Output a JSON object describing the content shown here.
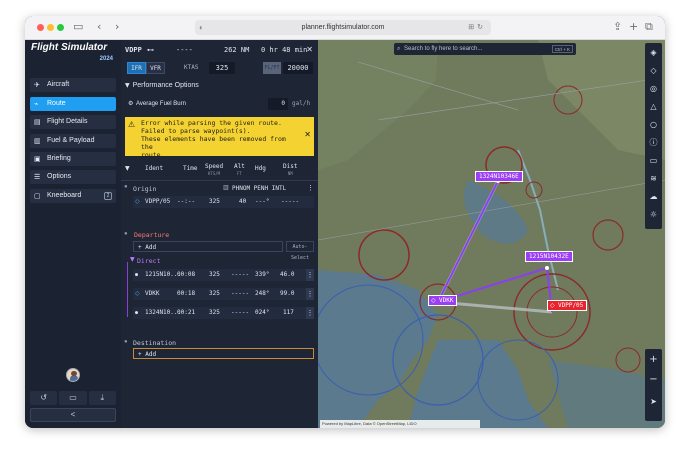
{
  "browser": {
    "url": "planner.flightsimulator.com"
  },
  "app": {
    "logo_text": "Flight Simulator",
    "logo_year": "2024"
  },
  "sidebar": {
    "items": [
      {
        "label": "Aircraft",
        "icon": "plane-icon"
      },
      {
        "label": "Route",
        "icon": "route-icon"
      },
      {
        "label": "Flight Details",
        "icon": "clipboard-icon"
      },
      {
        "label": "Fuel & Payload",
        "icon": "fuel-icon"
      },
      {
        "label": "Briefing",
        "icon": "briefing-icon"
      },
      {
        "label": "Options",
        "icon": "sliders-icon"
      },
      {
        "label": "Kneeboard",
        "icon": "kneeboard-icon",
        "badge": "2"
      }
    ],
    "active_index": 1,
    "bottom_buttons": [
      "undo-icon",
      "folder-icon",
      "download-icon"
    ],
    "collapse_label": "<"
  },
  "route_header": {
    "origin": "VDPP",
    "destination": "----",
    "distance": "262 NM",
    "time": "0 hr 48 min",
    "close": "✕"
  },
  "rules": {
    "ifr": "IFR",
    "vfr": "VFR",
    "active": "IFR",
    "ktas_label": "KTAS",
    "ktas_value": "325",
    "fl_button": "FL/FT",
    "altitude": "20000"
  },
  "performance": {
    "title": "Performance Options",
    "fuel_label": "Average Fuel Burn",
    "fuel_value": "0",
    "fuel_unit": "gal/h"
  },
  "error": {
    "line1": "Error while parsing the given route.",
    "line2": "Failed to parse waypoint(s).",
    "line3": "These elements have been removed from the",
    "line4": "route."
  },
  "table": {
    "headers": {
      "ident": "Ident",
      "time": "Time",
      "speed": "Speed",
      "speed_unit": "KTS/M",
      "alt": "Alt",
      "alt_unit": "FT",
      "hdg": "Hdg",
      "dist": "Dist",
      "dist_unit": "NM"
    }
  },
  "origin": {
    "label": "Origin",
    "airport_name": "PHNOM PENH INTL",
    "row": {
      "ident": "VDPP/05",
      "time": "--:--",
      "speed": "325",
      "alt": "40",
      "hdg": "---°",
      "dist": "-----"
    }
  },
  "departure": {
    "label": "Departure",
    "add_label": "+ Add",
    "auto_label": "Auto-Select"
  },
  "direct": {
    "label": "Direct",
    "rows": [
      {
        "ident": "1215N10...",
        "time": "00:08",
        "speed": "325",
        "alt": "-----",
        "hdg": "339°",
        "dist": "46.0"
      },
      {
        "ident": "VDKK",
        "time": "00:18",
        "speed": "325",
        "alt": "-----",
        "hdg": "248°",
        "dist": "99.0"
      },
      {
        "ident": "1324N10...",
        "time": "00:21",
        "speed": "325",
        "alt": "-----",
        "hdg": "024°",
        "dist": "117"
      }
    ]
  },
  "destination": {
    "label": "Destination",
    "add_label": "+ Add"
  },
  "map": {
    "search_placeholder": "Search to fly here to search...",
    "search_kbd": "Ctrl + K",
    "waypoints": [
      {
        "label": "1324N10346E"
      },
      {
        "label": "1215N10432E"
      },
      {
        "label": "VDKK"
      },
      {
        "label": "VDPP/05"
      }
    ],
    "attribution": "Powered by MapLibre, Data © OpenStreetMap, LIDO",
    "colors": {
      "route": "#8a3ff2",
      "origin": "#e8232e",
      "waypoint": "#9b3ff2",
      "land": "#6f7b5c",
      "water": "#5b7a8d"
    },
    "toolbar_icons": [
      "layers-icon",
      "center-icon",
      "target-icon",
      "triangle-icon",
      "circle-icon",
      "info-icon",
      "ruler-icon",
      "wind-icon",
      "weather-icon",
      "sun-icon"
    ],
    "zoom_icons": [
      "zoom-in-icon",
      "zoom-out-icon",
      "compass-icon"
    ]
  }
}
